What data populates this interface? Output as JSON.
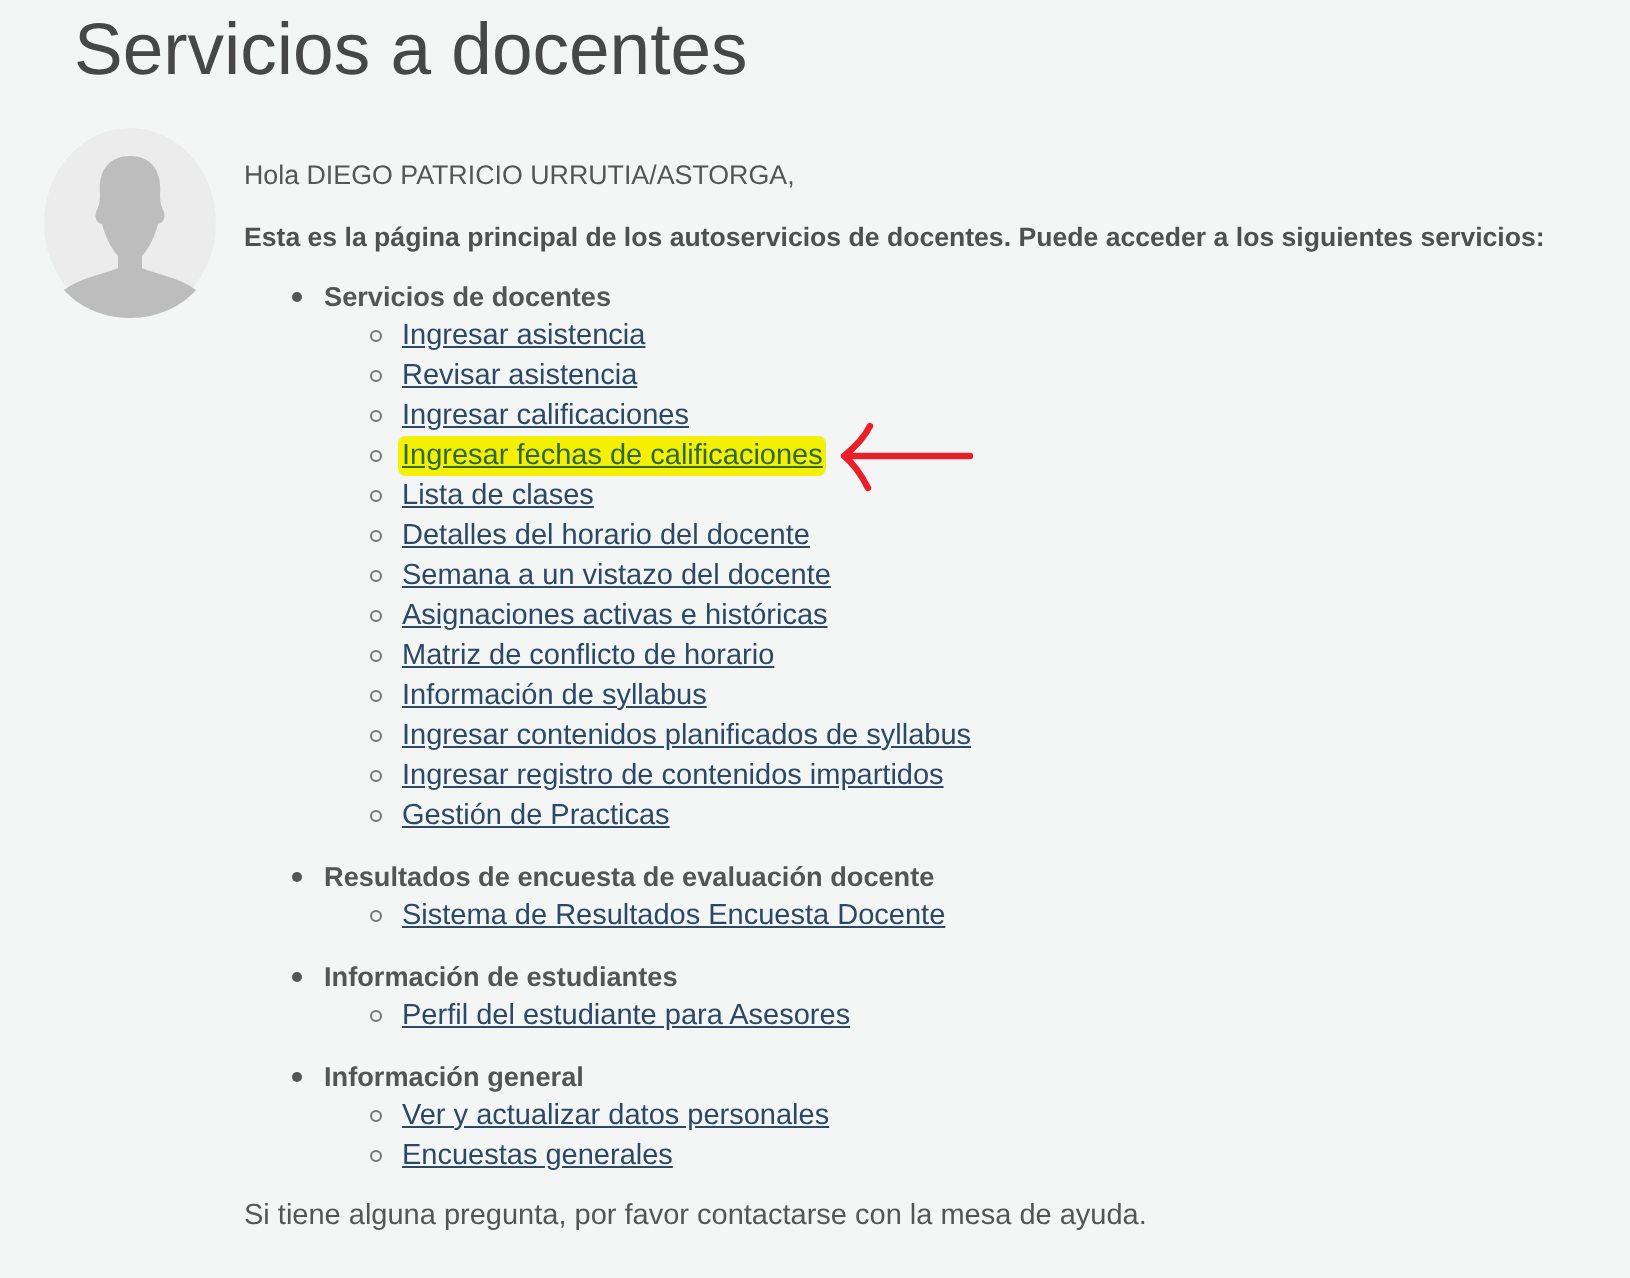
{
  "page": {
    "title": "Servicios a docentes"
  },
  "greeting": "Hola DIEGO PATRICIO URRUTIA/ASTORGA,",
  "intro": "Esta es la página principal de los autoservicios de docentes. Puede acceder a los siguientes servicios:",
  "sections": [
    {
      "heading": "Servicios de docentes",
      "links": [
        {
          "label": "Ingresar asistencia",
          "highlighted": false,
          "arrow": false
        },
        {
          "label": "Revisar asistencia",
          "highlighted": false,
          "arrow": false
        },
        {
          "label": "Ingresar calificaciones",
          "highlighted": false,
          "arrow": false
        },
        {
          "label": "Ingresar fechas de calificaciones",
          "highlighted": true,
          "arrow": true
        },
        {
          "label": "Lista de clases",
          "highlighted": false,
          "arrow": false
        },
        {
          "label": "Detalles del horario del docente",
          "highlighted": false,
          "arrow": false
        },
        {
          "label": "Semana a un vistazo del docente",
          "highlighted": false,
          "arrow": false
        },
        {
          "label": "Asignaciones activas e históricas",
          "highlighted": false,
          "arrow": false
        },
        {
          "label": "Matriz de conflicto de horario",
          "highlighted": false,
          "arrow": false
        },
        {
          "label": "Información de syllabus",
          "highlighted": false,
          "arrow": false
        },
        {
          "label": "Ingresar contenidos planificados de syllabus",
          "highlighted": false,
          "arrow": false
        },
        {
          "label": "Ingresar registro de contenidos impartidos",
          "highlighted": false,
          "arrow": false
        },
        {
          "label": "Gestión de Practicas",
          "highlighted": false,
          "arrow": false
        }
      ]
    },
    {
      "heading": "Resultados de encuesta de evaluación docente",
      "links": [
        {
          "label": "Sistema de Resultados Encuesta Docente",
          "highlighted": false,
          "arrow": false
        }
      ]
    },
    {
      "heading": "Información de estudiantes",
      "links": [
        {
          "label": "Perfil del estudiante para Asesores",
          "highlighted": false,
          "arrow": false
        }
      ]
    },
    {
      "heading": "Información general",
      "links": [
        {
          "label": "Ver y actualizar datos personales",
          "highlighted": false,
          "arrow": false
        },
        {
          "label": "Encuestas generales",
          "highlighted": false,
          "arrow": false
        }
      ]
    }
  ],
  "footer": "Si tiene alguna pregunta, por favor contactarse con la mesa de ayuda."
}
